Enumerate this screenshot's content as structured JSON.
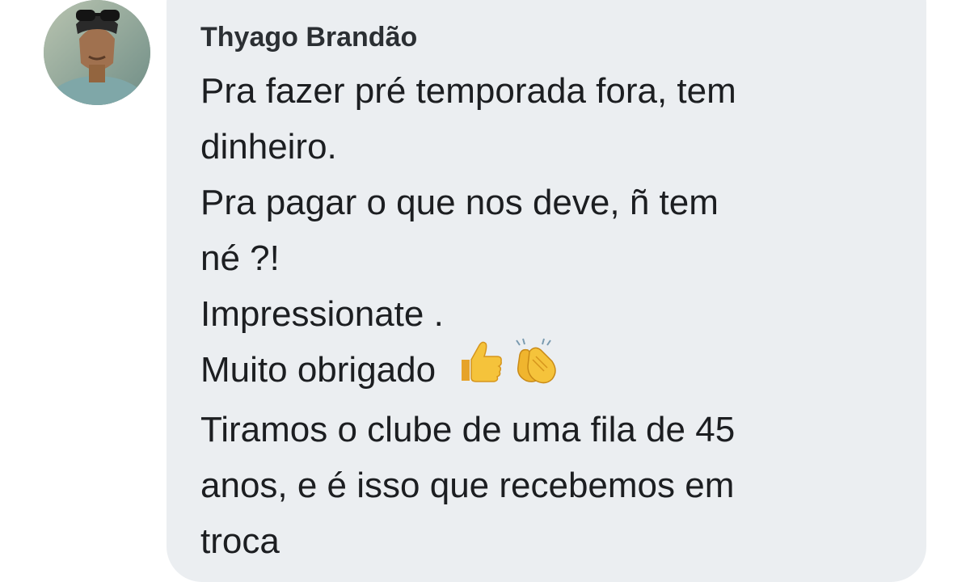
{
  "comment": {
    "author": "Thyago Brandão",
    "lines": [
      "Pra fazer pré temporada fora, tem",
      "dinheiro.",
      "Pra pagar o que nos deve, ñ tem",
      "né ?!",
      "Impressionate .",
      "Muito obrigado",
      "Tiramos o clube de uma fila de 45",
      "anos, e é isso que recebemos em",
      "troca"
    ],
    "emojis": [
      "thumbs-up-icon",
      "clapping-hands-icon"
    ]
  },
  "colors": {
    "bubble": "#ebeef1",
    "text": "#1c1e21",
    "author": "#2b2f33",
    "emoji": "#f5c33b"
  }
}
